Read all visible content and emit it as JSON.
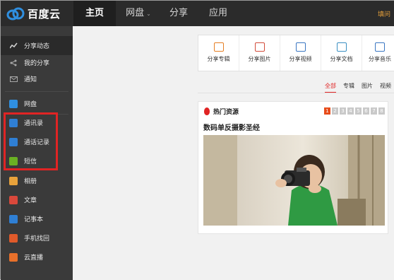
{
  "header": {
    "logo_text": "百度云",
    "nav": [
      {
        "label": "主页",
        "active": true
      },
      {
        "label": "网盘",
        "caret": "⌄"
      },
      {
        "label": "分享"
      },
      {
        "label": "应用"
      }
    ],
    "right_text": "填问"
  },
  "sidebar": {
    "items": [
      {
        "label": "分享动态",
        "icon": "activity-icon"
      },
      {
        "label": "我的分享",
        "icon": "share-icon"
      },
      {
        "label": "通知",
        "icon": "mail-icon"
      },
      {
        "label": "网盘",
        "icon": "cloud-icon"
      },
      {
        "label": "通讯录",
        "icon": "contacts-icon"
      },
      {
        "label": "通话记录",
        "icon": "call-log-icon"
      },
      {
        "label": "短信",
        "icon": "sms-icon"
      },
      {
        "label": "相册",
        "icon": "album-icon"
      },
      {
        "label": "文章",
        "icon": "article-icon"
      },
      {
        "label": "记事本",
        "icon": "notepad-icon"
      },
      {
        "label": "手机找回",
        "icon": "phone-find-icon"
      },
      {
        "label": "云直播",
        "icon": "cloud-live-icon"
      }
    ]
  },
  "quickbar": {
    "items": [
      {
        "label": "分享专辑",
        "icon": "album-share-icon",
        "color": "#e67e22"
      },
      {
        "label": "分享图片",
        "icon": "picture-icon",
        "color": "#d24b3a"
      },
      {
        "label": "分享视频",
        "icon": "video-icon",
        "color": "#3a76c2"
      },
      {
        "label": "分享文档",
        "icon": "document-icon",
        "color": "#3a8fc2"
      },
      {
        "label": "分享音乐",
        "icon": "music-icon",
        "color": "#3a76c2"
      }
    ]
  },
  "filters": {
    "tabs": [
      {
        "label": "全部",
        "active": true
      },
      {
        "label": "专辑"
      },
      {
        "label": "图片"
      },
      {
        "label": "视频"
      }
    ]
  },
  "hot": {
    "title": "热门资源",
    "subtitle": "数码单反摄影圣经",
    "pages": [
      "1",
      "2",
      "3",
      "4",
      "5",
      "6",
      "7",
      "8"
    ],
    "active_page": "1"
  },
  "colors": {
    "accent_red": "#e02424",
    "topbar": "#2b2b2b",
    "sidebar": "#3a3a3a"
  }
}
